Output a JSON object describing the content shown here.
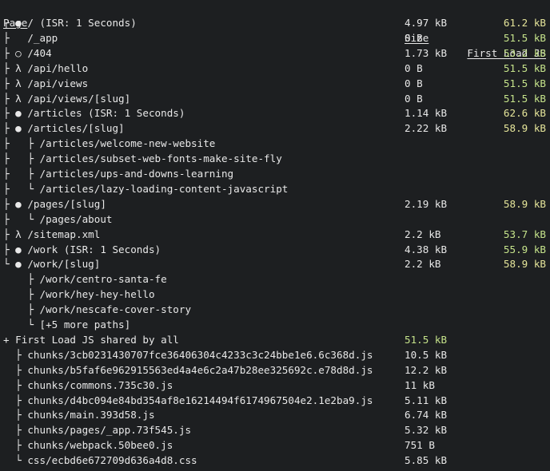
{
  "colors": {
    "background": "#1d1f21",
    "text": "#e8e8e8",
    "first_load_good": "#c6e48b",
    "first_load_warn": "#e5e59a"
  },
  "header": {
    "page": "Page",
    "size": "Size",
    "first_load": "First Load JS"
  },
  "routes": [
    {
      "prefix": "┌ ● ",
      "path": "/ (ISR: 1 Seconds)",
      "size": "4.97 kB",
      "first_load": "61.2 kB",
      "level": "warn"
    },
    {
      "prefix": "├   ",
      "path": "/_app",
      "size": "0 B",
      "first_load": "51.5 kB",
      "level": "good"
    },
    {
      "prefix": "├ ○ ",
      "path": "/404",
      "size": "1.73 kB",
      "first_load": "53.2 kB",
      "level": "good"
    },
    {
      "prefix": "├ λ ",
      "path": "/api/hello",
      "size": "0 B",
      "first_load": "51.5 kB",
      "level": "good"
    },
    {
      "prefix": "├ λ ",
      "path": "/api/views",
      "size": "0 B",
      "first_load": "51.5 kB",
      "level": "good"
    },
    {
      "prefix": "├ λ ",
      "path": "/api/views/[slug]",
      "size": "0 B",
      "first_load": "51.5 kB",
      "level": "good"
    },
    {
      "prefix": "├ ● ",
      "path": "/articles (ISR: 1 Seconds)",
      "size": "1.14 kB",
      "first_load": "62.6 kB",
      "level": "warn"
    },
    {
      "prefix": "├ ● ",
      "path": "/articles/[slug]",
      "size": "2.22 kB",
      "first_load": "58.9 kB",
      "level": "warn"
    },
    {
      "prefix": "├   ├ ",
      "path": "/articles/welcome-new-website",
      "size": "",
      "first_load": "",
      "level": "good"
    },
    {
      "prefix": "├   ├ ",
      "path": "/articles/subset-web-fonts-make-site-fly",
      "size": "",
      "first_load": "",
      "level": "good"
    },
    {
      "prefix": "├   ├ ",
      "path": "/articles/ups-and-downs-learning",
      "size": "",
      "first_load": "",
      "level": "good"
    },
    {
      "prefix": "├   └ ",
      "path": "/articles/lazy-loading-content-javascript",
      "size": "",
      "first_load": "",
      "level": "good"
    },
    {
      "prefix": "├ ● ",
      "path": "/pages/[slug]",
      "size": "2.19 kB",
      "first_load": "58.9 kB",
      "level": "warn"
    },
    {
      "prefix": "├   └ ",
      "path": "/pages/about",
      "size": "",
      "first_load": "",
      "level": "good"
    },
    {
      "prefix": "├ λ ",
      "path": "/sitemap.xml",
      "size": "2.2 kB",
      "first_load": "53.7 kB",
      "level": "good"
    },
    {
      "prefix": "├ ● ",
      "path": "/work (ISR: 1 Seconds)",
      "size": "4.38 kB",
      "first_load": "55.9 kB",
      "level": "good"
    },
    {
      "prefix": "└ ● ",
      "path": "/work/[slug]",
      "size": "2.2 kB",
      "first_load": "58.9 kB",
      "level": "warn"
    },
    {
      "prefix": "    ├ ",
      "path": "/work/centro-santa-fe",
      "size": "",
      "first_load": "",
      "level": "good"
    },
    {
      "prefix": "    ├ ",
      "path": "/work/hey-hey-hello",
      "size": "",
      "first_load": "",
      "level": "good"
    },
    {
      "prefix": "    ├ ",
      "path": "/work/nescafe-cover-story",
      "size": "",
      "first_load": "",
      "level": "good"
    },
    {
      "prefix": "    └ ",
      "path": "[+5 more paths]",
      "size": "",
      "first_load": "",
      "level": "good"
    }
  ],
  "shared": {
    "label": "+ First Load JS shared by all",
    "value": "51.5 kB",
    "chunks": [
      {
        "prefix": "  ├ ",
        "name": "chunks/3cb0231430707fce36406304c4233c3c24bbe1e6.6c368d.js",
        "size": "10.5 kB"
      },
      {
        "prefix": "  ├ ",
        "name": "chunks/b5faf6e962915563ed4a4e6c2a47b28ee325692c.e78d8d.js",
        "size": "12.2 kB"
      },
      {
        "prefix": "  ├ ",
        "name": "chunks/commons.735c30.js",
        "size": "11 kB"
      },
      {
        "prefix": "  ├ ",
        "name": "chunks/d4bc094e84bd354af8e16214494f6174967504e2.1e2ba9.js",
        "size": "5.11 kB"
      },
      {
        "prefix": "  ├ ",
        "name": "chunks/main.393d58.js",
        "size": "6.74 kB"
      },
      {
        "prefix": "  ├ ",
        "name": "chunks/pages/_app.73f545.js",
        "size": "5.32 kB"
      },
      {
        "prefix": "  ├ ",
        "name": "chunks/webpack.50bee0.js",
        "size": "751 B"
      },
      {
        "prefix": "  └ ",
        "name": "css/ecbd6e672709d636a4d8.css",
        "size": "5.85 kB"
      }
    ]
  }
}
